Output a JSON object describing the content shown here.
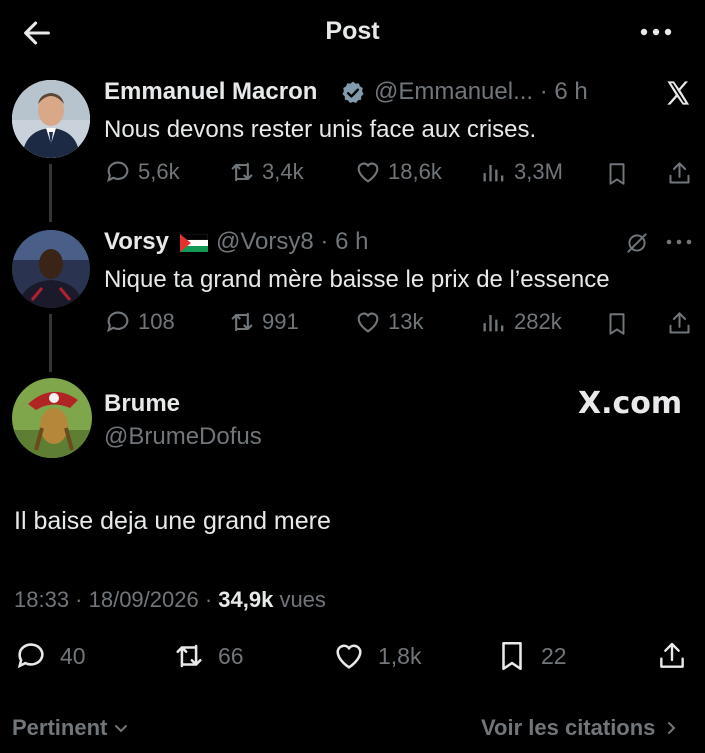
{
  "header": {
    "title": "Post"
  },
  "tweets": [
    {
      "name": "Emmanuel Macron",
      "handle_time": "@Emmanuel... · 6 h",
      "text": "Nous devons rester unis face aux crises.",
      "replies": "5,6k",
      "reposts": "3,4k",
      "likes": "18,6k",
      "views": "3,3M"
    },
    {
      "name": "Vorsy",
      "handle_time": "@Vorsy8 · 6 h",
      "text": "Nique ta grand mère baisse le prix de l’essence",
      "replies": "108",
      "reposts": "991",
      "likes": "13k",
      "views": "282k"
    }
  ],
  "main": {
    "name": "Brume",
    "handle": "@BrumeDofus",
    "watermark": "X.com",
    "text": "Il baise deja une grand mere",
    "time": "18:33 · 18/09/2026 · ",
    "views_count": "34,9k",
    "views_label": " vues",
    "replies": "40",
    "reposts": "66",
    "likes": "1,8k",
    "bookmarks": "22"
  },
  "footer": {
    "left": "Pertinent",
    "right": "Voir les citations"
  },
  "colors": {
    "background": "#000000",
    "text": "#e7e9ea",
    "muted": "#71767b",
    "verified": "#829aab"
  },
  "icons": [
    "back-arrow-icon",
    "more-icon",
    "verified-badge-icon",
    "x-logo-icon",
    "palestine-flag-icon",
    "grok-icon",
    "reply-icon",
    "repost-icon",
    "like-icon",
    "views-icon",
    "bookmark-icon",
    "share-icon",
    "chevron-down-icon",
    "chevron-right-icon"
  ]
}
